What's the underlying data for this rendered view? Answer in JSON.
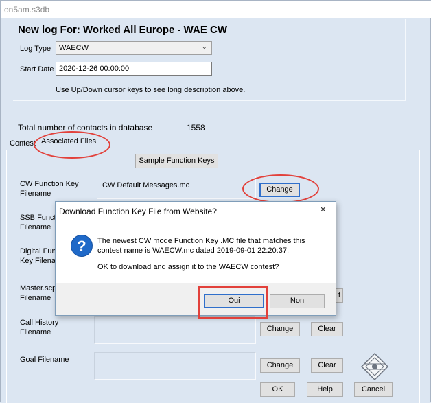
{
  "window": {
    "title": "on5am.s3db"
  },
  "header": {
    "title": "New log For: Worked All Europe - WAE CW",
    "log_type_label": "Log Type",
    "log_type_value": "WAECW",
    "start_date_label": "Start Date",
    "start_date_value": "2020-12-26 00:00:00",
    "hint": "Use Up/Down cursor keys to see long description above."
  },
  "stats": {
    "label": "Total number of contacts in database",
    "count": "1558"
  },
  "tabs": [
    {
      "label": "Contest"
    },
    {
      "label": "Associated Files"
    }
  ],
  "files": {
    "sample_button": "Sample Function Keys",
    "cw_label_1": "CW Function Key",
    "cw_label_2": "Filename",
    "cw_value": "CW Default Messages.mc",
    "ssb_label_1": "SSB Funct",
    "ssb_label_2": "Filename",
    "digital_label_1": "Digital Fun",
    "digital_label_2": "Key Filena",
    "master_label_1": "Master.scp",
    "master_label_2": "Filename",
    "callhist_label_1": "Call History",
    "callhist_label_2": "Filename",
    "goal_label": "Goal Filename",
    "change": "Change",
    "clear": "Clear",
    "partial_right": "t"
  },
  "footer": {
    "ok": "OK",
    "help": "Help",
    "cancel": "Cancel"
  },
  "dialog": {
    "title": "Download Function Key File from Website?",
    "close": "×",
    "message_line1": "The newest CW mode Function Key .MC file that matches this",
    "message_line2": "contest name is WAECW.mc dated 2019-09-01 22:20:37.",
    "message_line3": "OK to download and assign it to the WAECW contest?",
    "yes": "Oui",
    "no": "Non"
  },
  "colors": {
    "annotation": "#e2413b",
    "focus": "#2f6fcb",
    "form_bg": "#dce6f2"
  },
  "icons": {
    "question": "question-icon",
    "logo": "logo-icon",
    "dropdown": "chevron-down-icon"
  }
}
